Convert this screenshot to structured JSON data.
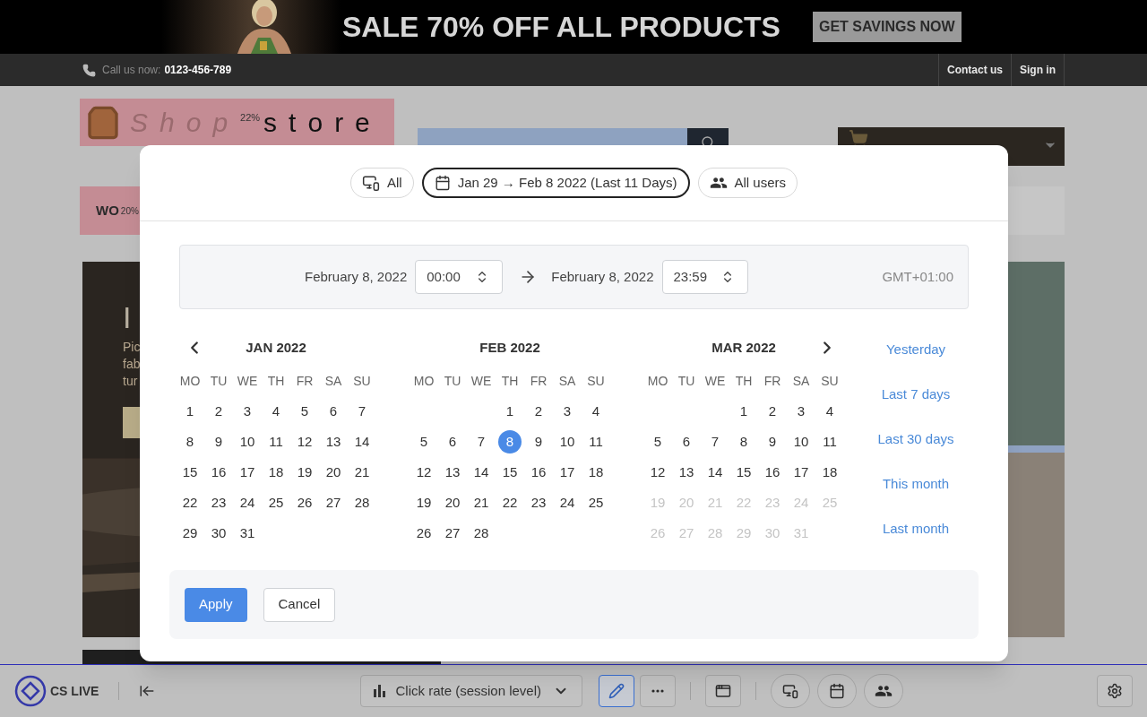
{
  "banner": {
    "headline": "SALE 70% OFF ALL PRODUCTS",
    "button": "GET SAVINGS NOW"
  },
  "top_bar": {
    "call_label": "Call us now:",
    "phone": "0123-456-789",
    "links": [
      "Contact us",
      "Sign in"
    ]
  },
  "shop": {
    "logo_light": "Shop",
    "logo_dark": "store",
    "logo_badge": "22%",
    "menu_label": "WO",
    "menu_badge": "20%",
    "hero_title": "I",
    "hero_lines": [
      "Pic",
      "fab",
      "tur"
    ]
  },
  "modal": {
    "filters": [
      {
        "kind": "devices",
        "label": "All",
        "selected": false
      },
      {
        "kind": "date",
        "label": "Jan 29 → Feb 8 2022 (Last 11 Days)",
        "selected": true
      },
      {
        "kind": "users",
        "label": "All users",
        "selected": false
      }
    ],
    "range": {
      "start_date": "February 8, 2022",
      "start_time": "00:00",
      "end_date": "February 8, 2022",
      "end_time": "23:59",
      "timezone": "GMT+01:00"
    },
    "months": [
      {
        "title": "JAN 2022",
        "weekdays": [
          "MO",
          "TU",
          "WE",
          "TH",
          "FR",
          "SA",
          "SU"
        ],
        "weeks": [
          [
            {
              "kind": "day",
              "day": "1",
              "selected": false,
              "disabled": false
            },
            {
              "kind": "day",
              "day": "2",
              "selected": false,
              "disabled": false
            },
            {
              "kind": "day",
              "day": "3",
              "selected": false,
              "disabled": false
            },
            {
              "kind": "day",
              "day": "4",
              "selected": false,
              "disabled": false
            },
            {
              "kind": "day",
              "day": "5",
              "selected": false,
              "disabled": false
            },
            {
              "kind": "day",
              "day": "6",
              "selected": false,
              "disabled": false
            },
            {
              "kind": "day",
              "day": "7",
              "selected": false,
              "disabled": false
            }
          ],
          [
            {
              "kind": "day",
              "day": "8",
              "selected": false,
              "disabled": false
            },
            {
              "kind": "day",
              "day": "9",
              "selected": false,
              "disabled": false
            },
            {
              "kind": "day",
              "day": "10",
              "selected": false,
              "disabled": false
            },
            {
              "kind": "day",
              "day": "11",
              "selected": false,
              "disabled": false
            },
            {
              "kind": "day",
              "day": "12",
              "selected": false,
              "disabled": false
            },
            {
              "kind": "day",
              "day": "13",
              "selected": false,
              "disabled": false
            },
            {
              "kind": "day",
              "day": "14",
              "selected": false,
              "disabled": false
            }
          ],
          [
            {
              "kind": "day",
              "day": "15",
              "selected": false,
              "disabled": false
            },
            {
              "kind": "day",
              "day": "16",
              "selected": false,
              "disabled": false
            },
            {
              "kind": "day",
              "day": "17",
              "selected": false,
              "disabled": false
            },
            {
              "kind": "day",
              "day": "18",
              "selected": false,
              "disabled": false
            },
            {
              "kind": "day",
              "day": "19",
              "selected": false,
              "disabled": false
            },
            {
              "kind": "day",
              "day": "20",
              "selected": false,
              "disabled": false
            },
            {
              "kind": "day",
              "day": "21",
              "selected": false,
              "disabled": false
            }
          ],
          [
            {
              "kind": "day",
              "day": "22",
              "selected": false,
              "disabled": false
            },
            {
              "kind": "day",
              "day": "23",
              "selected": false,
              "disabled": false
            },
            {
              "kind": "day",
              "day": "24",
              "selected": false,
              "disabled": false
            },
            {
              "kind": "day",
              "day": "25",
              "selected": false,
              "disabled": false
            },
            {
              "kind": "day",
              "day": "26",
              "selected": false,
              "disabled": false
            },
            {
              "kind": "day",
              "day": "27",
              "selected": false,
              "disabled": false
            },
            {
              "kind": "day",
              "day": "28",
              "selected": false,
              "disabled": false
            }
          ],
          [
            {
              "kind": "day",
              "day": "29",
              "selected": false,
              "disabled": false
            },
            {
              "kind": "day",
              "day": "30",
              "selected": false,
              "disabled": false
            },
            {
              "kind": "day",
              "day": "31",
              "selected": false,
              "disabled": false
            },
            {
              "kind": "empty"
            },
            {
              "kind": "empty"
            },
            {
              "kind": "empty"
            },
            {
              "kind": "empty"
            }
          ]
        ]
      },
      {
        "title": "FEB 2022",
        "weekdays": [
          "MO",
          "TU",
          "WE",
          "TH",
          "FR",
          "SA",
          "SU"
        ],
        "weeks": [
          [
            {
              "kind": "empty"
            },
            {
              "kind": "empty"
            },
            {
              "kind": "empty"
            },
            {
              "kind": "day",
              "day": "1",
              "selected": false,
              "disabled": false
            },
            {
              "kind": "day",
              "day": "2",
              "selected": false,
              "disabled": false
            },
            {
              "kind": "day",
              "day": "3",
              "selected": false,
              "disabled": false
            },
            {
              "kind": "day",
              "day": "4",
              "selected": false,
              "disabled": false
            }
          ],
          [
            {
              "kind": "day",
              "day": "5",
              "selected": false,
              "disabled": false
            },
            {
              "kind": "day",
              "day": "6",
              "selected": false,
              "disabled": false
            },
            {
              "kind": "day",
              "day": "7",
              "selected": false,
              "disabled": false
            },
            {
              "kind": "day",
              "day": "8",
              "selected": true,
              "disabled": false
            },
            {
              "kind": "day",
              "day": "9",
              "selected": false,
              "disabled": false
            },
            {
              "kind": "day",
              "day": "10",
              "selected": false,
              "disabled": false
            },
            {
              "kind": "day",
              "day": "11",
              "selected": false,
              "disabled": false
            }
          ],
          [
            {
              "kind": "day",
              "day": "12",
              "selected": false,
              "disabled": false
            },
            {
              "kind": "day",
              "day": "13",
              "selected": false,
              "disabled": false
            },
            {
              "kind": "day",
              "day": "14",
              "selected": false,
              "disabled": false
            },
            {
              "kind": "day",
              "day": "15",
              "selected": false,
              "disabled": false
            },
            {
              "kind": "day",
              "day": "16",
              "selected": false,
              "disabled": false
            },
            {
              "kind": "day",
              "day": "17",
              "selected": false,
              "disabled": false
            },
            {
              "kind": "day",
              "day": "18",
              "selected": false,
              "disabled": false
            }
          ],
          [
            {
              "kind": "day",
              "day": "19",
              "selected": false,
              "disabled": false
            },
            {
              "kind": "day",
              "day": "20",
              "selected": false,
              "disabled": false
            },
            {
              "kind": "day",
              "day": "21",
              "selected": false,
              "disabled": false
            },
            {
              "kind": "day",
              "day": "22",
              "selected": false,
              "disabled": false
            },
            {
              "kind": "day",
              "day": "23",
              "selected": false,
              "disabled": false
            },
            {
              "kind": "day",
              "day": "24",
              "selected": false,
              "disabled": false
            },
            {
              "kind": "day",
              "day": "25",
              "selected": false,
              "disabled": false
            }
          ],
          [
            {
              "kind": "day",
              "day": "26",
              "selected": false,
              "disabled": false
            },
            {
              "kind": "day",
              "day": "27",
              "selected": false,
              "disabled": false
            },
            {
              "kind": "day",
              "day": "28",
              "selected": false,
              "disabled": false
            },
            {
              "kind": "empty"
            },
            {
              "kind": "empty"
            },
            {
              "kind": "empty"
            },
            {
              "kind": "empty"
            }
          ]
        ]
      },
      {
        "title": "MAR 2022",
        "weekdays": [
          "MO",
          "TU",
          "WE",
          "TH",
          "FR",
          "SA",
          "SU"
        ],
        "weeks": [
          [
            {
              "kind": "empty"
            },
            {
              "kind": "empty"
            },
            {
              "kind": "empty"
            },
            {
              "kind": "day",
              "day": "1",
              "selected": false,
              "disabled": false
            },
            {
              "kind": "day",
              "day": "2",
              "selected": false,
              "disabled": false
            },
            {
              "kind": "day",
              "day": "3",
              "selected": false,
              "disabled": false
            },
            {
              "kind": "day",
              "day": "4",
              "selected": false,
              "disabled": false
            }
          ],
          [
            {
              "kind": "day",
              "day": "5",
              "selected": false,
              "disabled": false
            },
            {
              "kind": "day",
              "day": "6",
              "selected": false,
              "disabled": false
            },
            {
              "kind": "day",
              "day": "7",
              "selected": false,
              "disabled": false
            },
            {
              "kind": "day",
              "day": "8",
              "selected": false,
              "disabled": false
            },
            {
              "kind": "day",
              "day": "9",
              "selected": false,
              "disabled": false
            },
            {
              "kind": "day",
              "day": "10",
              "selected": false,
              "disabled": false
            },
            {
              "kind": "day",
              "day": "11",
              "selected": false,
              "disabled": false
            }
          ],
          [
            {
              "kind": "day",
              "day": "12",
              "selected": false,
              "disabled": false
            },
            {
              "kind": "day",
              "day": "13",
              "selected": false,
              "disabled": false
            },
            {
              "kind": "day",
              "day": "14",
              "selected": false,
              "disabled": false
            },
            {
              "kind": "day",
              "day": "15",
              "selected": false,
              "disabled": false
            },
            {
              "kind": "day",
              "day": "16",
              "selected": false,
              "disabled": false
            },
            {
              "kind": "day",
              "day": "17",
              "selected": false,
              "disabled": false
            },
            {
              "kind": "day",
              "day": "18",
              "selected": false,
              "disabled": false
            }
          ],
          [
            {
              "kind": "day",
              "day": "19",
              "selected": false,
              "disabled": true
            },
            {
              "kind": "day",
              "day": "20",
              "selected": false,
              "disabled": true
            },
            {
              "kind": "day",
              "day": "21",
              "selected": false,
              "disabled": true
            },
            {
              "kind": "day",
              "day": "22",
              "selected": false,
              "disabled": true
            },
            {
              "kind": "day",
              "day": "23",
              "selected": false,
              "disabled": true
            },
            {
              "kind": "day",
              "day": "24",
              "selected": false,
              "disabled": true
            },
            {
              "kind": "day",
              "day": "25",
              "selected": false,
              "disabled": true
            }
          ],
          [
            {
              "kind": "day",
              "day": "26",
              "selected": false,
              "disabled": true
            },
            {
              "kind": "day",
              "day": "27",
              "selected": false,
              "disabled": true
            },
            {
              "kind": "day",
              "day": "28",
              "selected": false,
              "disabled": true
            },
            {
              "kind": "day",
              "day": "29",
              "selected": false,
              "disabled": true
            },
            {
              "kind": "day",
              "day": "30",
              "selected": false,
              "disabled": true
            },
            {
              "kind": "day",
              "day": "31",
              "selected": false,
              "disabled": true
            },
            {
              "kind": "empty"
            }
          ]
        ]
      }
    ],
    "presets": [
      "Yesterday",
      "Last 7 days",
      "Last 30 days",
      "This month",
      "Last month"
    ],
    "buttons": [
      {
        "kind": "primary",
        "label": "Apply"
      },
      {
        "kind": "secondary",
        "label": "Cancel"
      }
    ]
  },
  "toolbar": {
    "logo": "CS LIVE",
    "metric": "Click rate (session level)",
    "tools": [
      {
        "kind": "edit",
        "selected": true
      },
      {
        "kind": "more",
        "selected": false
      },
      {
        "kind": "window",
        "selected": false
      },
      {
        "kind": "devices",
        "selected": false
      },
      {
        "kind": "calendar",
        "selected": false
      },
      {
        "kind": "users",
        "selected": false
      },
      {
        "kind": "settings",
        "selected": false
      }
    ]
  }
}
